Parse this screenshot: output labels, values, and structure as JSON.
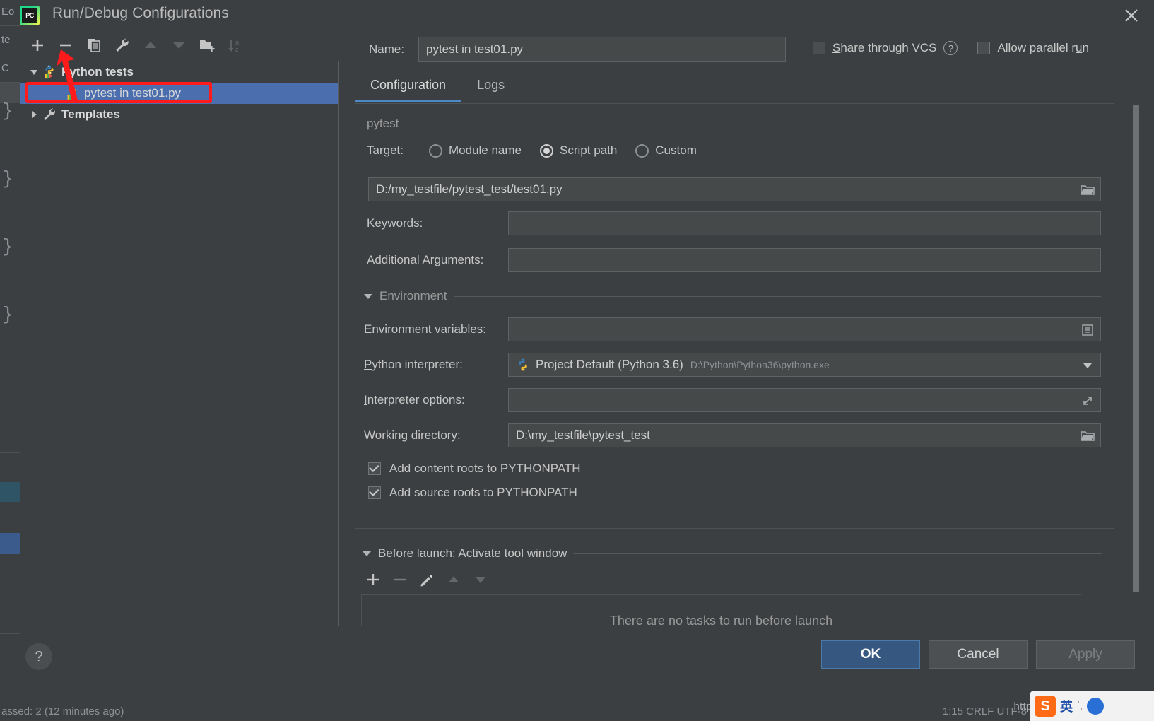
{
  "window": {
    "title": "Run/Debug Configurations",
    "logo_text": "PC",
    "close_icon": "close-icon"
  },
  "tree_toolbar": {
    "items": [
      {
        "name": "add-configuration",
        "icon": "plus-icon",
        "enabled": true
      },
      {
        "name": "remove-configuration",
        "icon": "minus-icon",
        "enabled": true
      },
      {
        "name": "copy-configuration",
        "icon": "copy-icon",
        "enabled": true
      },
      {
        "name": "edit-templates",
        "icon": "wrench-icon",
        "enabled": true
      },
      {
        "name": "move-up",
        "icon": "arrow-up-icon",
        "enabled": false
      },
      {
        "name": "move-down",
        "icon": "arrow-down-icon",
        "enabled": false
      },
      {
        "name": "new-folder",
        "icon": "folder-add-icon",
        "enabled": true
      },
      {
        "name": "sort-alphabetically",
        "icon": "sort-az-icon",
        "enabled": false
      }
    ]
  },
  "tree": {
    "nodes": [
      {
        "label": "Python tests",
        "type": "group",
        "expanded": true,
        "icon": "pytest-icon",
        "selected": false
      },
      {
        "label": "pytest in test01.py",
        "type": "config",
        "expanded": false,
        "icon": "pytest-icon",
        "selected": true
      },
      {
        "label": "Templates",
        "type": "group",
        "expanded": false,
        "icon": "wrench-icon",
        "selected": false
      }
    ]
  },
  "header": {
    "name_label": "Name:",
    "name_value": "pytest in test01.py",
    "share_vcs_label": "Share through VCS",
    "share_vcs_checked": false,
    "help_icon": "question-mark-icon",
    "allow_parallel_label": "Allow parallel run",
    "allow_parallel_checked": false
  },
  "tabs": [
    {
      "label": "Configuration",
      "active": true
    },
    {
      "label": "Logs",
      "active": false
    }
  ],
  "config": {
    "section_pytest": "pytest",
    "target_label": "Target:",
    "target_options": [
      {
        "label": "Module name",
        "selected": false
      },
      {
        "label": "Script path",
        "selected": true
      },
      {
        "label": "Custom",
        "selected": false
      }
    ],
    "script_path_value": "D:/my_testfile/pytest_test/test01.py",
    "script_path_browse_icon": "folder-icon",
    "keywords_label": "Keywords:",
    "keywords_value": "",
    "additional_arguments_label": "Additional Arguments:",
    "additional_arguments_value": "",
    "section_environment": "Environment",
    "env_vars_label": "Environment variables:",
    "env_vars_value": "",
    "env_vars_icon": "list-edit-icon",
    "python_interpreter_label": "Python interpreter:",
    "python_interpreter_value": "Project Default (Python 3.6)",
    "python_interpreter_path": "D:\\Python\\Python36\\python.exe",
    "python_interpreter_icon": "python-icon",
    "python_interpreter_dropdown_icon": "chevron-down-icon",
    "interpreter_options_label": "Interpreter options:",
    "interpreter_options_value": "",
    "interpreter_options_icon": "expand-icon",
    "working_directory_label": "Working directory:",
    "working_directory_value": "D:\\my_testfile\\pytest_test",
    "working_directory_browse_icon": "folder-icon",
    "add_content_roots_label": "Add content roots to PYTHONPATH",
    "add_content_roots_checked": true,
    "add_source_roots_label": "Add source roots to PYTHONPATH",
    "add_source_roots_checked": true
  },
  "before_launch": {
    "title": "Before launch: Activate tool window",
    "toolbar": [
      {
        "name": "add-task",
        "icon": "plus-icon",
        "enabled": true
      },
      {
        "name": "remove-task",
        "icon": "minus-icon",
        "enabled": false
      },
      {
        "name": "edit-task",
        "icon": "pencil-icon",
        "enabled": true
      },
      {
        "name": "move-task-up",
        "icon": "arrow-up-icon",
        "enabled": false
      },
      {
        "name": "move-task-down",
        "icon": "arrow-down-icon",
        "enabled": false
      }
    ],
    "empty_message": "There are no tasks to run before launch"
  },
  "footer": {
    "help_label": "?",
    "ok_label": "OK",
    "cancel_label": "Cancel",
    "apply_label": "Apply",
    "apply_enabled": false
  },
  "watermark": {
    "url": "https://blog.csdn.net",
    "ime_logo": "S",
    "ime_text": "英",
    "ime_sub": "ʼ,"
  },
  "background": {
    "left_lines": [
      "Eo",
      "te",
      "C"
    ],
    "bottom_left": "assed: 2 (12 minutes ago)",
    "bottom_right": "1:15    CRLF    UTF-8"
  },
  "colors": {
    "dialog_bg": "#3c3f41",
    "field_bg": "#45494a",
    "selection_blue": "#4b6eaf",
    "accent_blue": "#4a88c7",
    "primary_button": "#365880",
    "annotation_red": "#ff1b1b"
  }
}
